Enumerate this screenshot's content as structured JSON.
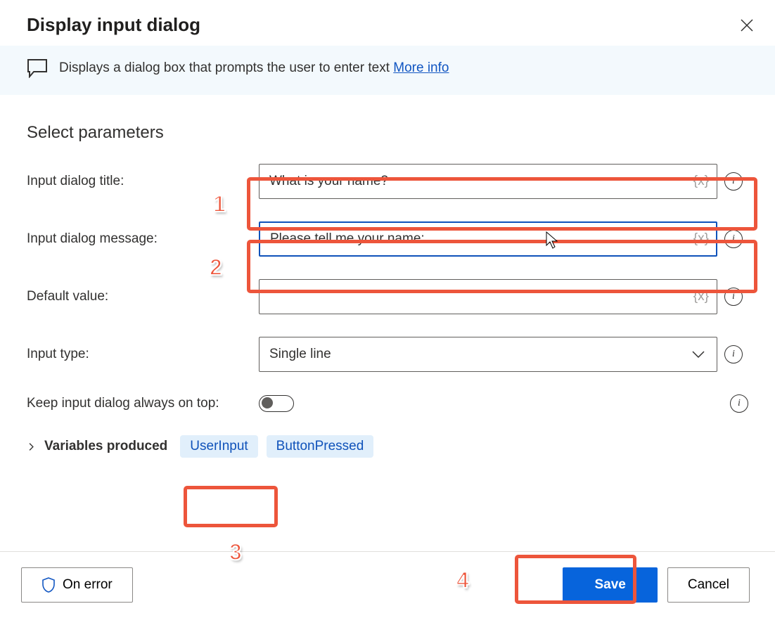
{
  "header": {
    "title": "Display input dialog"
  },
  "description": {
    "text": "Displays a dialog box that prompts the user to enter text ",
    "more_label": "More info"
  },
  "section": {
    "heading": "Select parameters"
  },
  "fields": {
    "title": {
      "label": "Input dialog title:",
      "value": "What is your name?",
      "var_token": "{x}"
    },
    "message": {
      "label": "Input dialog message:",
      "value": "Please tell me your name:",
      "var_token": "{x}"
    },
    "default": {
      "label": "Default value:",
      "value": "",
      "var_token": "{x}"
    },
    "input_type": {
      "label": "Input type:",
      "value": "Single line"
    },
    "on_top": {
      "label": "Keep input dialog always on top:"
    }
  },
  "variables": {
    "label": "Variables produced",
    "chips": [
      "UserInput",
      "ButtonPressed"
    ]
  },
  "footer": {
    "on_error": "On error",
    "save": "Save",
    "cancel": "Cancel"
  },
  "annotations": {
    "n1": "1",
    "n2": "2",
    "n3": "3",
    "n4": "4"
  }
}
